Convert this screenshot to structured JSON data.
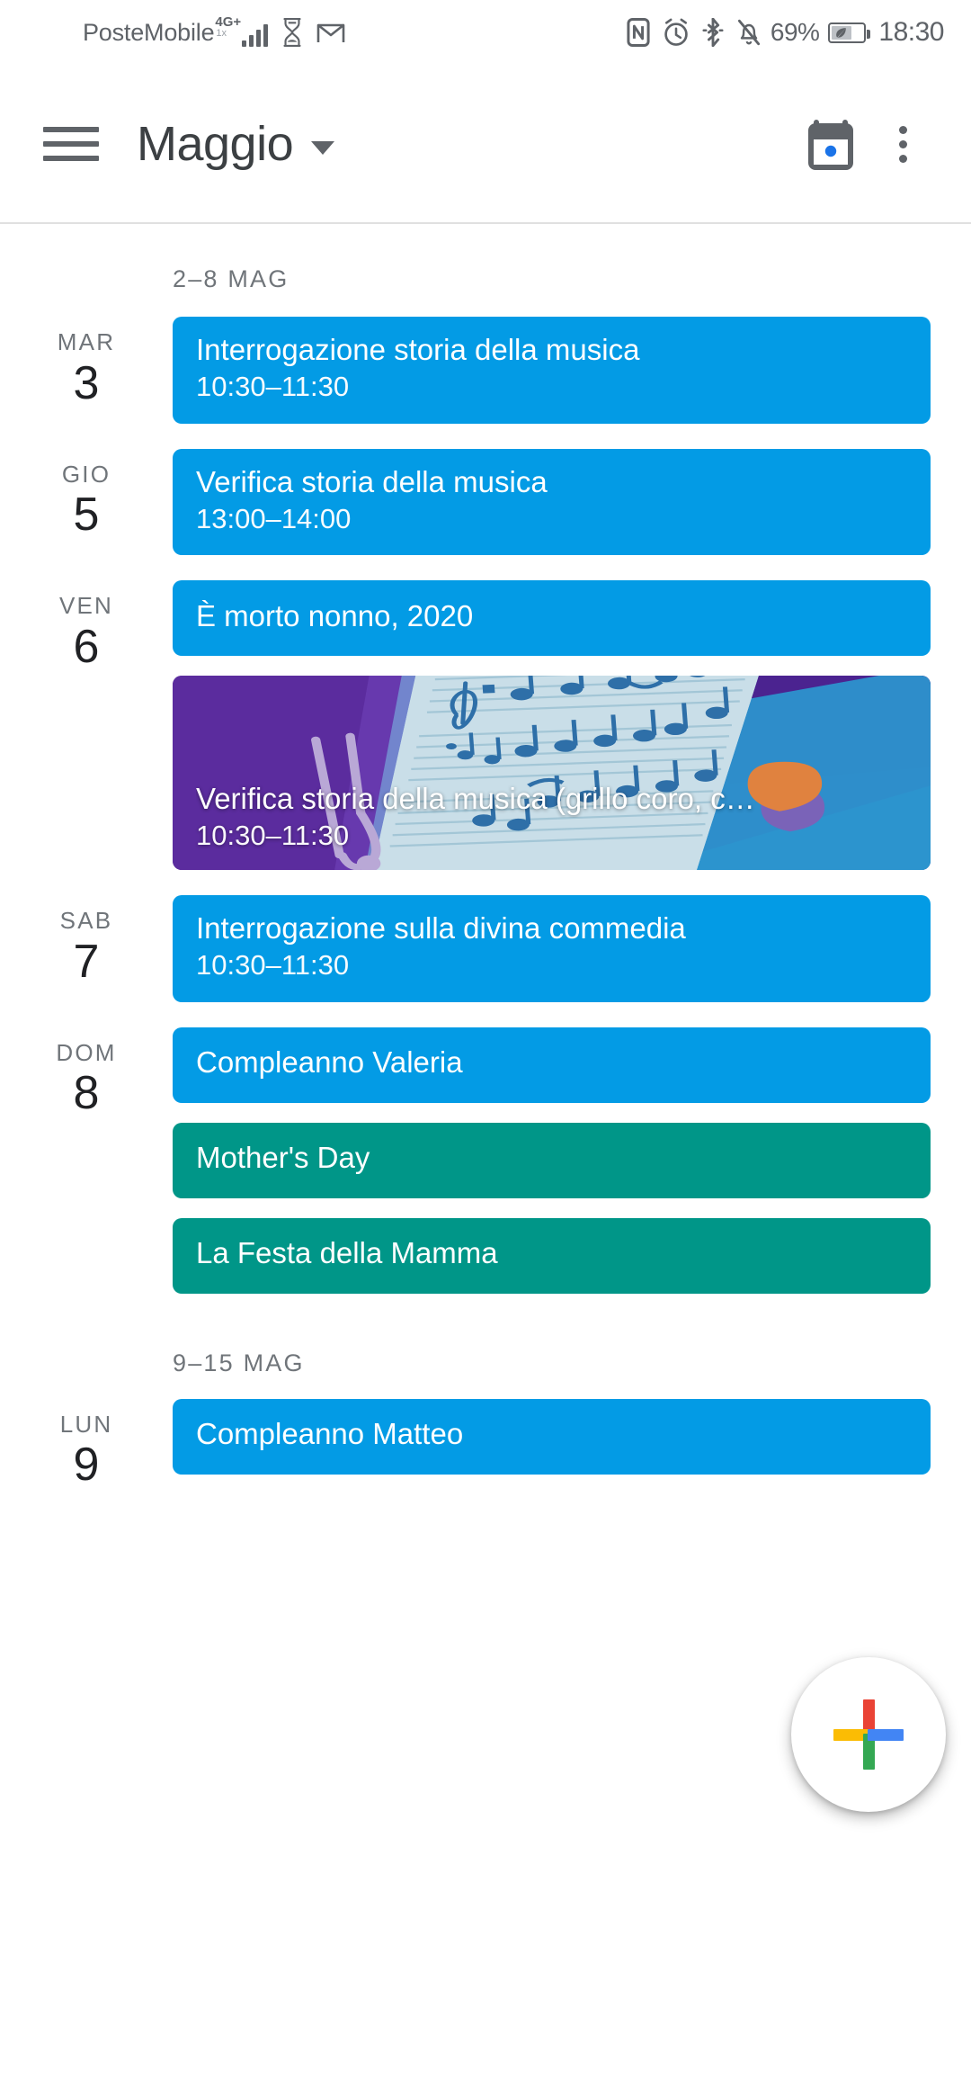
{
  "status_bar": {
    "carrier": "PosteMobile",
    "network_type": "4G+",
    "network_sub": "1x",
    "icons": [
      "hourglass-icon",
      "gmail-icon",
      "nfc-icon",
      "alarm-icon",
      "bluetooth-icon",
      "notifications-muted-icon"
    ],
    "battery_percent": "69%",
    "battery_saver_icon": "leaf-icon",
    "time": "18:30"
  },
  "app_bar": {
    "menu_icon": "hamburger-menu-icon",
    "title": "Maggio",
    "dropdown_icon": "chevron-down-icon",
    "today_icon": "calendar-today-icon",
    "overflow_icon": "more-vert-icon"
  },
  "colors": {
    "event_blue": "#039BE5",
    "event_teal": "#009688",
    "image_event_bg": "#5B2C9E",
    "text_secondary": "#70757a",
    "text_primary": "#202124",
    "fab_red": "#EA4335",
    "fab_blue": "#4285F4",
    "fab_yellow": "#FBBC04",
    "fab_green": "#34A853"
  },
  "weeks": [
    {
      "label": "2–8 MAG",
      "days": [
        {
          "dow": "MAR",
          "num": "3",
          "events": [
            {
              "type": "chip",
              "color": "#039BE5",
              "title": "Interrogazione storia della musica",
              "time": "10:30–11:30"
            }
          ]
        },
        {
          "dow": "GIO",
          "num": "5",
          "events": [
            {
              "type": "chip",
              "color": "#039BE5",
              "title": "Verifica storia della musica",
              "time": "13:00–14:00"
            }
          ]
        },
        {
          "dow": "VEN",
          "num": "6",
          "events": [
            {
              "type": "chip",
              "color": "#039BE5",
              "title": "È morto nonno, 2020",
              "time": ""
            },
            {
              "type": "image",
              "color": "#5B2C9E",
              "title": "Verifica storia della musica (grillo coro, c…",
              "time": "10:30–11:30",
              "art": "sheet-music-illustration"
            }
          ]
        },
        {
          "dow": "SAB",
          "num": "7",
          "events": [
            {
              "type": "chip",
              "color": "#039BE5",
              "title": "Interrogazione sulla divina commedia",
              "time": "10:30–11:30"
            }
          ]
        },
        {
          "dow": "DOM",
          "num": "8",
          "events": [
            {
              "type": "chip",
              "color": "#039BE5",
              "title": "Compleanno Valeria",
              "time": ""
            },
            {
              "type": "chip",
              "color": "#009688",
              "title": "Mother's Day",
              "time": ""
            },
            {
              "type": "chip",
              "color": "#009688",
              "title": "La Festa della Mamma",
              "time": ""
            }
          ]
        }
      ]
    },
    {
      "label": "9–15 MAG",
      "days": [
        {
          "dow": "LUN",
          "num": "9",
          "events": [
            {
              "type": "chip",
              "color": "#039BE5",
              "title": "Compleanno Matteo",
              "time": ""
            }
          ]
        }
      ]
    }
  ],
  "fab": {
    "name": "create-event-fab",
    "icon": "google-plus-icon"
  }
}
